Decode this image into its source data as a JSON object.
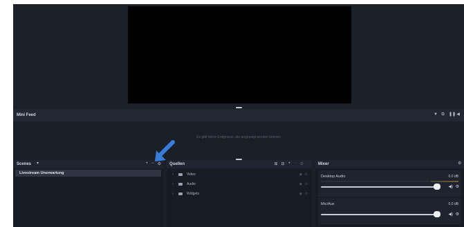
{
  "minifeed": {
    "title": "Mini Feed",
    "message": "Es gibt keine Ereignisse, die angezeigt werden können",
    "icons": [
      "filter-icon",
      "expand-icon",
      "pause-icon",
      "volume-icon"
    ]
  },
  "scenes": {
    "title": "Scenes",
    "dropdown_glyph": "▾",
    "add_glyph": "+",
    "remove_glyph": "−",
    "settings_glyph": "⚙",
    "items": [
      {
        "label": "Livestream Unerwartung"
      }
    ]
  },
  "sources": {
    "title": "Quellen",
    "items": [
      {
        "label": "Video"
      },
      {
        "label": "Audio"
      },
      {
        "label": "Widgets"
      }
    ]
  },
  "mixer": {
    "title": "Mixer",
    "channels": [
      {
        "name": "Desktop Audio",
        "db": "0.0 dB",
        "level": 1.0
      },
      {
        "name": "Mic/Aux",
        "db": "0.0 dB",
        "level": 1.0
      }
    ]
  },
  "colors": {
    "background": "#1a1f28",
    "panel_header": "#1f2430",
    "selected_row": "#2e3442",
    "annotation_arrow": "#3a7bd5"
  }
}
